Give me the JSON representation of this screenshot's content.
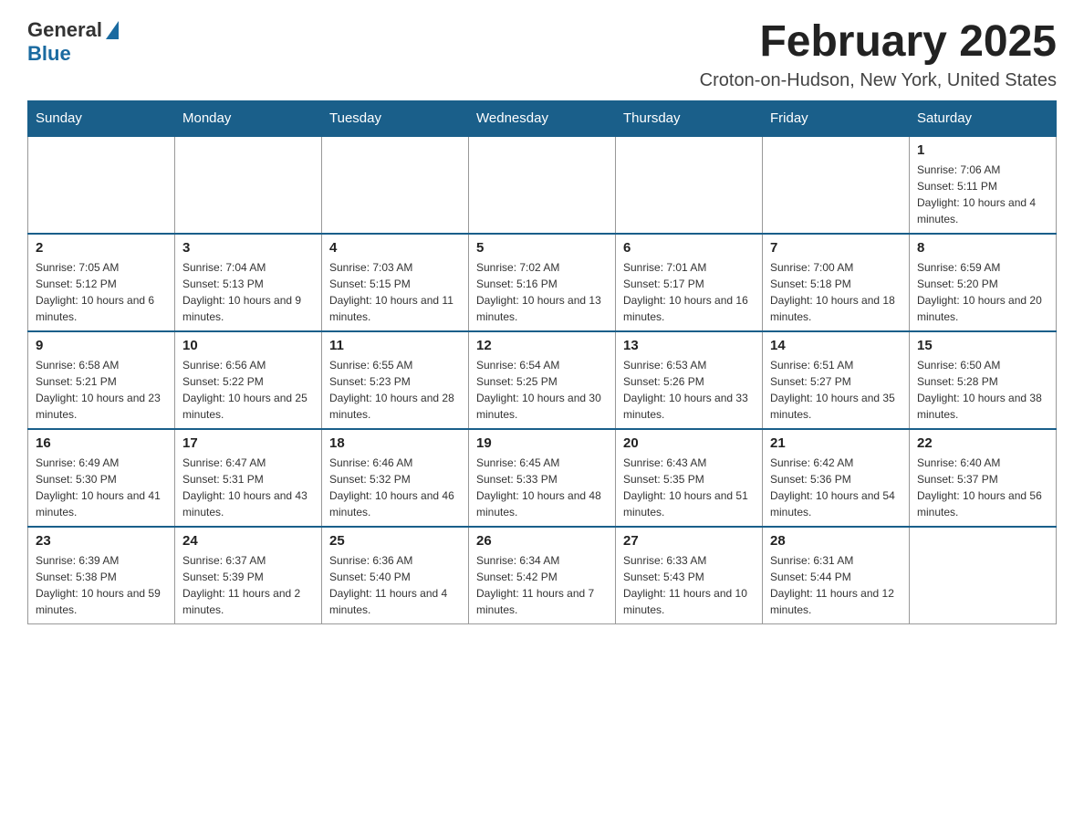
{
  "logo": {
    "text_general": "General",
    "text_blue": "Blue"
  },
  "title": "February 2025",
  "subtitle": "Croton-on-Hudson, New York, United States",
  "days_of_week": [
    "Sunday",
    "Monday",
    "Tuesday",
    "Wednesday",
    "Thursday",
    "Friday",
    "Saturday"
  ],
  "weeks": [
    [
      {
        "day": "",
        "info": ""
      },
      {
        "day": "",
        "info": ""
      },
      {
        "day": "",
        "info": ""
      },
      {
        "day": "",
        "info": ""
      },
      {
        "day": "",
        "info": ""
      },
      {
        "day": "",
        "info": ""
      },
      {
        "day": "1",
        "info": "Sunrise: 7:06 AM\nSunset: 5:11 PM\nDaylight: 10 hours and 4 minutes."
      }
    ],
    [
      {
        "day": "2",
        "info": "Sunrise: 7:05 AM\nSunset: 5:12 PM\nDaylight: 10 hours and 6 minutes."
      },
      {
        "day": "3",
        "info": "Sunrise: 7:04 AM\nSunset: 5:13 PM\nDaylight: 10 hours and 9 minutes."
      },
      {
        "day": "4",
        "info": "Sunrise: 7:03 AM\nSunset: 5:15 PM\nDaylight: 10 hours and 11 minutes."
      },
      {
        "day": "5",
        "info": "Sunrise: 7:02 AM\nSunset: 5:16 PM\nDaylight: 10 hours and 13 minutes."
      },
      {
        "day": "6",
        "info": "Sunrise: 7:01 AM\nSunset: 5:17 PM\nDaylight: 10 hours and 16 minutes."
      },
      {
        "day": "7",
        "info": "Sunrise: 7:00 AM\nSunset: 5:18 PM\nDaylight: 10 hours and 18 minutes."
      },
      {
        "day": "8",
        "info": "Sunrise: 6:59 AM\nSunset: 5:20 PM\nDaylight: 10 hours and 20 minutes."
      }
    ],
    [
      {
        "day": "9",
        "info": "Sunrise: 6:58 AM\nSunset: 5:21 PM\nDaylight: 10 hours and 23 minutes."
      },
      {
        "day": "10",
        "info": "Sunrise: 6:56 AM\nSunset: 5:22 PM\nDaylight: 10 hours and 25 minutes."
      },
      {
        "day": "11",
        "info": "Sunrise: 6:55 AM\nSunset: 5:23 PM\nDaylight: 10 hours and 28 minutes."
      },
      {
        "day": "12",
        "info": "Sunrise: 6:54 AM\nSunset: 5:25 PM\nDaylight: 10 hours and 30 minutes."
      },
      {
        "day": "13",
        "info": "Sunrise: 6:53 AM\nSunset: 5:26 PM\nDaylight: 10 hours and 33 minutes."
      },
      {
        "day": "14",
        "info": "Sunrise: 6:51 AM\nSunset: 5:27 PM\nDaylight: 10 hours and 35 minutes."
      },
      {
        "day": "15",
        "info": "Sunrise: 6:50 AM\nSunset: 5:28 PM\nDaylight: 10 hours and 38 minutes."
      }
    ],
    [
      {
        "day": "16",
        "info": "Sunrise: 6:49 AM\nSunset: 5:30 PM\nDaylight: 10 hours and 41 minutes."
      },
      {
        "day": "17",
        "info": "Sunrise: 6:47 AM\nSunset: 5:31 PM\nDaylight: 10 hours and 43 minutes."
      },
      {
        "day": "18",
        "info": "Sunrise: 6:46 AM\nSunset: 5:32 PM\nDaylight: 10 hours and 46 minutes."
      },
      {
        "day": "19",
        "info": "Sunrise: 6:45 AM\nSunset: 5:33 PM\nDaylight: 10 hours and 48 minutes."
      },
      {
        "day": "20",
        "info": "Sunrise: 6:43 AM\nSunset: 5:35 PM\nDaylight: 10 hours and 51 minutes."
      },
      {
        "day": "21",
        "info": "Sunrise: 6:42 AM\nSunset: 5:36 PM\nDaylight: 10 hours and 54 minutes."
      },
      {
        "day": "22",
        "info": "Sunrise: 6:40 AM\nSunset: 5:37 PM\nDaylight: 10 hours and 56 minutes."
      }
    ],
    [
      {
        "day": "23",
        "info": "Sunrise: 6:39 AM\nSunset: 5:38 PM\nDaylight: 10 hours and 59 minutes."
      },
      {
        "day": "24",
        "info": "Sunrise: 6:37 AM\nSunset: 5:39 PM\nDaylight: 11 hours and 2 minutes."
      },
      {
        "day": "25",
        "info": "Sunrise: 6:36 AM\nSunset: 5:40 PM\nDaylight: 11 hours and 4 minutes."
      },
      {
        "day": "26",
        "info": "Sunrise: 6:34 AM\nSunset: 5:42 PM\nDaylight: 11 hours and 7 minutes."
      },
      {
        "day": "27",
        "info": "Sunrise: 6:33 AM\nSunset: 5:43 PM\nDaylight: 11 hours and 10 minutes."
      },
      {
        "day": "28",
        "info": "Sunrise: 6:31 AM\nSunset: 5:44 PM\nDaylight: 11 hours and 12 minutes."
      },
      {
        "day": "",
        "info": ""
      }
    ]
  ]
}
